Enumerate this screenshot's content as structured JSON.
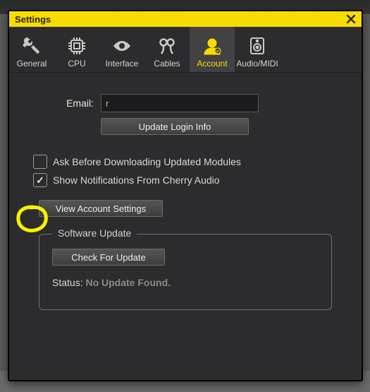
{
  "window": {
    "title": "Settings"
  },
  "tabs": [
    {
      "id": "general",
      "label": "General"
    },
    {
      "id": "cpu",
      "label": "CPU"
    },
    {
      "id": "interface",
      "label": "Interface"
    },
    {
      "id": "cables",
      "label": "Cables"
    },
    {
      "id": "account",
      "label": "Account"
    },
    {
      "id": "audiomidi",
      "label": "Audio/MIDI"
    }
  ],
  "email": {
    "label": "Email:",
    "value": "r"
  },
  "buttons": {
    "update_login": "Update Login Info",
    "view_account": "View Account Settings",
    "check_update": "Check For Update"
  },
  "checkboxes": {
    "ask_before_download": {
      "label": "Ask Before Downloading Updated Modules",
      "checked": false
    },
    "show_notifications": {
      "label": "Show Notifications From Cherry Audio",
      "checked": true
    }
  },
  "software_update": {
    "legend": "Software Update",
    "status_prefix": "Status: ",
    "status_value": "No Update Found."
  },
  "active_tab": "account"
}
